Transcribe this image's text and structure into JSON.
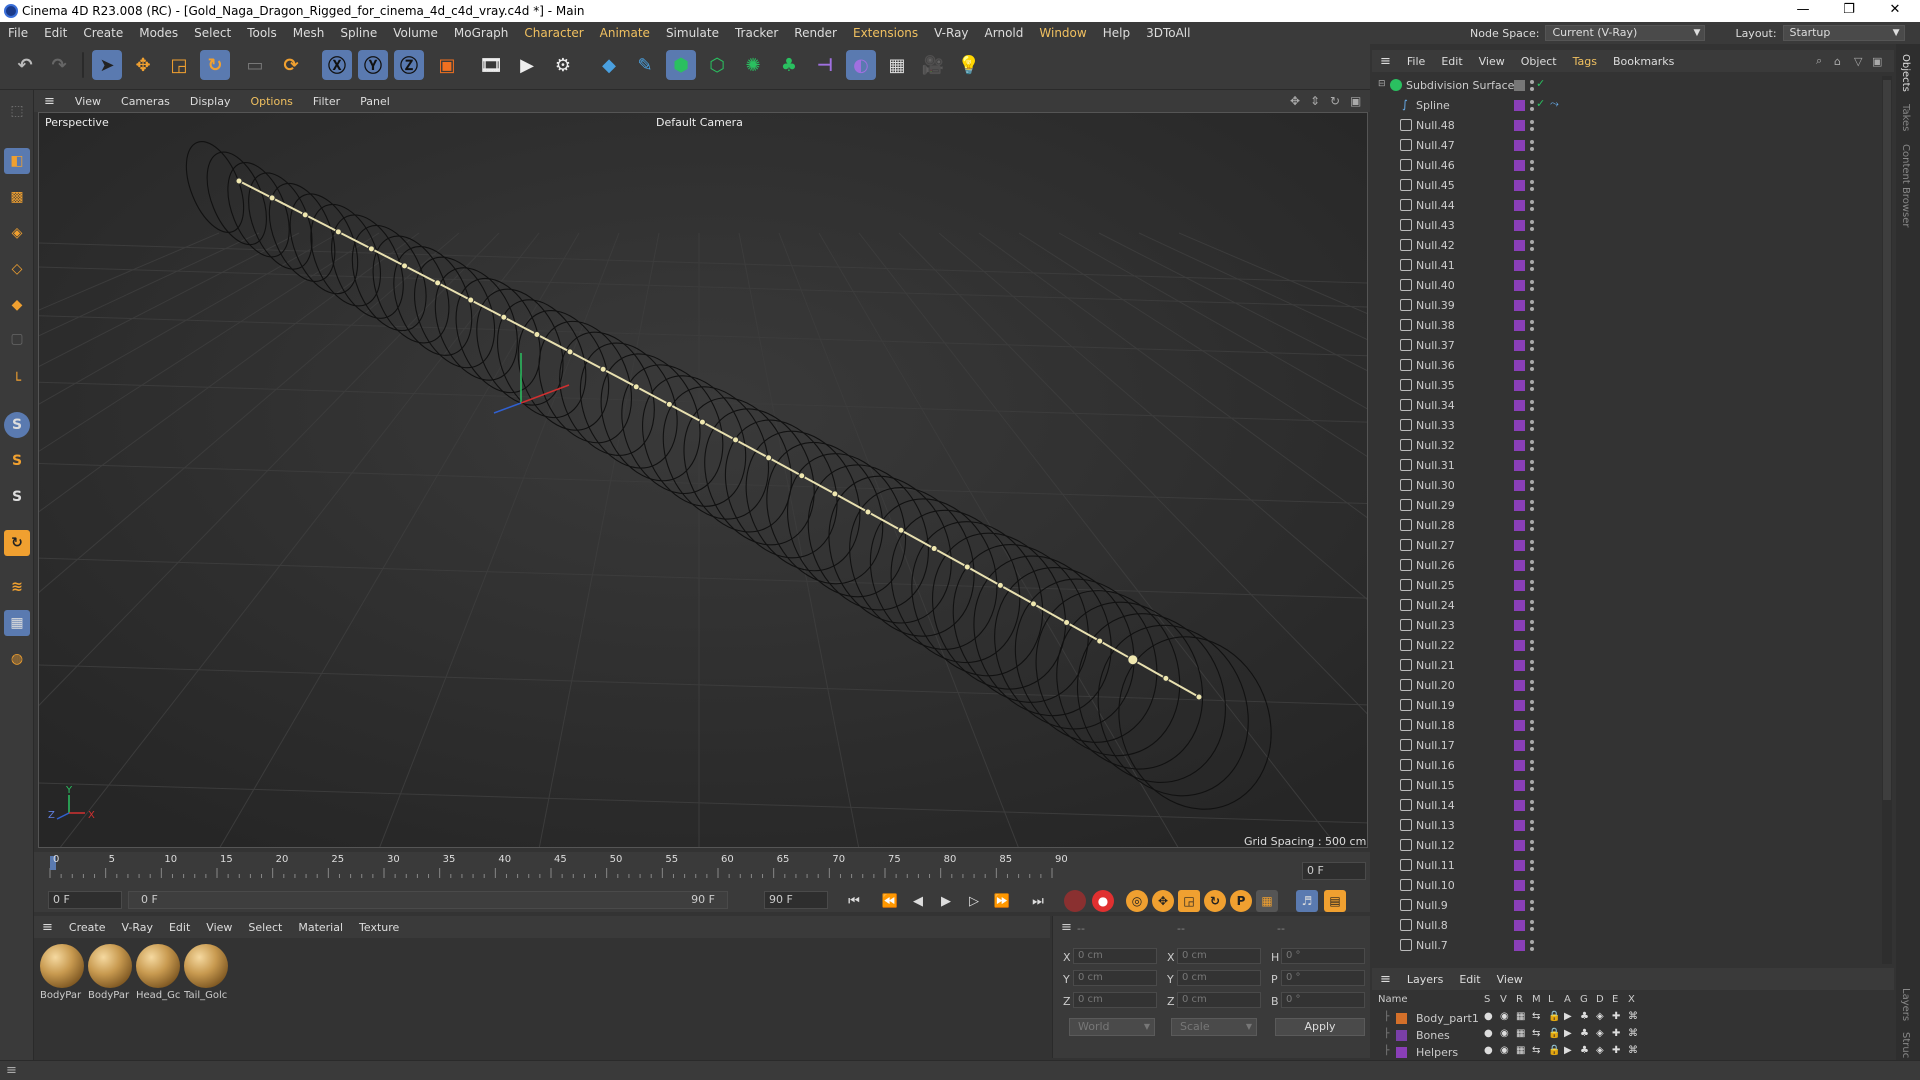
{
  "window": {
    "title": "Cinema 4D R23.008 (RC) - [Gold_Naga_Dragon_Rigged_for_cinema_4d_c4d_vray.c4d *] - Main",
    "minimize": "—",
    "maximize": "❐",
    "close": "✕"
  },
  "menubar": {
    "items": [
      "File",
      "Edit",
      "Create",
      "Modes",
      "Select",
      "Tools",
      "Mesh",
      "Spline",
      "Volume",
      "MoGraph",
      "Character",
      "Animate",
      "Simulate",
      "Tracker",
      "Render",
      "Extensions",
      "V-Ray",
      "Arnold",
      "Window",
      "Help",
      "3DToAll"
    ],
    "node_space_label": "Node Space:",
    "node_space_value": "Current (V-Ray)",
    "layout_label": "Layout:",
    "layout_value": "Startup"
  },
  "viewport": {
    "menu": [
      "View",
      "Cameras",
      "Display",
      "Options",
      "Filter",
      "Panel"
    ],
    "label": "Perspective",
    "camera": "Default Camera",
    "grid_spacing": "Grid Spacing : 500 cm",
    "axis_y": "Y",
    "axis_z": "Z",
    "axis_x": "X"
  },
  "timeline": {
    "ticks": [
      "0",
      "5",
      "10",
      "15",
      "20",
      "25",
      "30",
      "35",
      "40",
      "45",
      "50",
      "55",
      "60",
      "65",
      "70",
      "75",
      "80",
      "85",
      "90"
    ],
    "current_frame": "0 F",
    "start_frame": "0 F",
    "range_start": "0 F",
    "range_end": "90 F",
    "end_frame": "90 F"
  },
  "material_manager": {
    "menu": [
      "Create",
      "V-Ray",
      "Edit",
      "View",
      "Select",
      "Material",
      "Texture"
    ],
    "materials": [
      "BodyPar",
      "BodyPar",
      "Head_Gc",
      "Tail_Golc"
    ]
  },
  "coordinates": {
    "header_dash1": "--",
    "header_dash2": "--",
    "header_dash3": "--",
    "rows": [
      {
        "l1": "X",
        "v1": "0 cm",
        "l2": "X",
        "v2": "0 cm",
        "l3": "H",
        "v3": "0 °"
      },
      {
        "l1": "Y",
        "v1": "0 cm",
        "l2": "Y",
        "v2": "0 cm",
        "l3": "P",
        "v3": "0 °"
      },
      {
        "l1": "Z",
        "v1": "0 cm",
        "l2": "Z",
        "v2": "0 cm",
        "l3": "B",
        "v3": "0 °"
      }
    ],
    "space": "World",
    "mode": "Scale",
    "apply": "Apply"
  },
  "object_manager": {
    "menu": [
      "File",
      "Edit",
      "View",
      "Object",
      "Tags",
      "Bookmarks"
    ],
    "root": "Subdivision Surface",
    "spline": "Spline",
    "nulls": [
      "Null.48",
      "Null.47",
      "Null.46",
      "Null.45",
      "Null.44",
      "Null.43",
      "Null.42",
      "Null.41",
      "Null.40",
      "Null.39",
      "Null.38",
      "Null.37",
      "Null.36",
      "Null.35",
      "Null.34",
      "Null.33",
      "Null.32",
      "Null.31",
      "Null.30",
      "Null.29",
      "Null.28",
      "Null.27",
      "Null.26",
      "Null.25",
      "Null.24",
      "Null.23",
      "Null.22",
      "Null.21",
      "Null.20",
      "Null.19",
      "Null.18",
      "Null.17",
      "Null.16",
      "Null.15",
      "Null.14",
      "Null.13",
      "Null.12",
      "Null.11",
      "Null.10",
      "Null.9",
      "Null.8",
      "Null.7"
    ],
    "tag_color": "#8a3fb8"
  },
  "layers": {
    "menu": [
      "Layers",
      "Edit",
      "View"
    ],
    "columns": [
      "Name",
      "S",
      "V",
      "R",
      "M",
      "L",
      "A",
      "G",
      "D",
      "E",
      "X"
    ],
    "rows": [
      {
        "name": "Body_part1",
        "color": "#d4702a"
      },
      {
        "name": "Bones",
        "color": "#7a3fa8"
      },
      {
        "name": "Helpers",
        "color": "#8a3fb8"
      }
    ]
  },
  "right_tabs": [
    "Objects",
    "Takes",
    "Content Browser",
    "Layers",
    "Struc"
  ]
}
